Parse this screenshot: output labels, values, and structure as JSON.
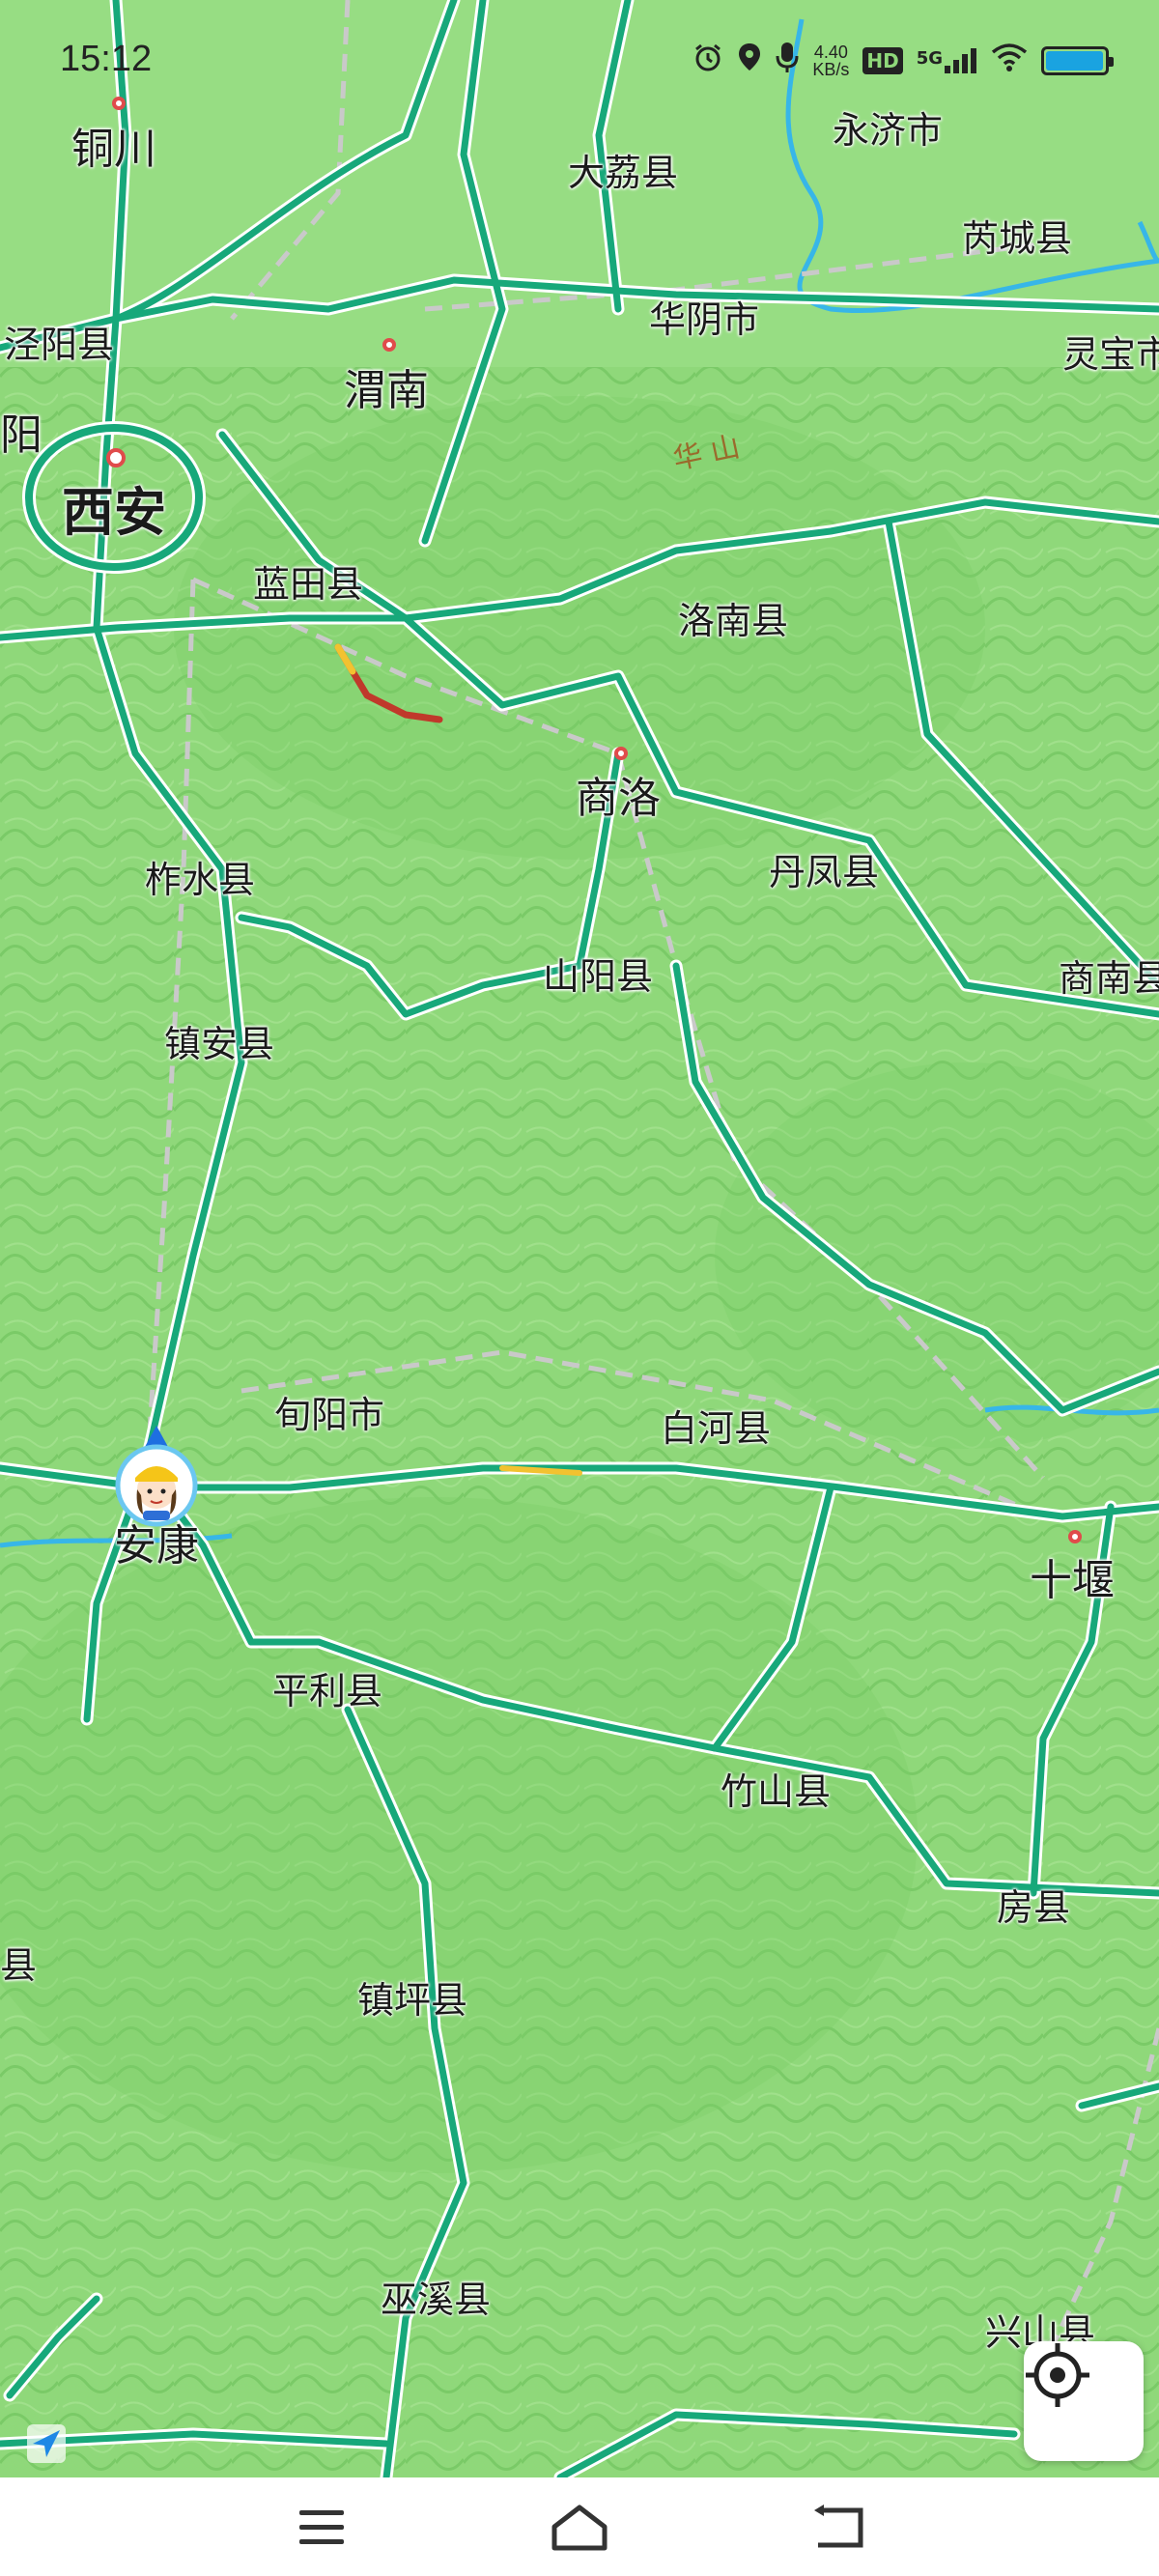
{
  "status_bar": {
    "time": "15:12",
    "net_speed_value": "4.40",
    "net_speed_unit": "KB/s",
    "hd_badge": "HD",
    "network_type": "5G",
    "battery_level": 0.92,
    "icons": [
      "alarm-icon",
      "location-icon",
      "microphone-icon",
      "hd-icon",
      "signal-icon",
      "wifi-icon",
      "battery-icon"
    ]
  },
  "map": {
    "place_labels": [
      {
        "id": "tongchuan",
        "text": "铜川",
        "kind": "city"
      },
      {
        "id": "dali",
        "text": "大荔县",
        "kind": "county"
      },
      {
        "id": "yongji",
        "text": "永济市",
        "kind": "county"
      },
      {
        "id": "ruicheng",
        "text": "芮城县",
        "kind": "county"
      },
      {
        "id": "jingyang",
        "text": "泾阳县",
        "kind": "county"
      },
      {
        "id": "weinan",
        "text": "渭南",
        "kind": "city"
      },
      {
        "id": "huayin",
        "text": "华阴市",
        "kind": "county"
      },
      {
        "id": "lingbao",
        "text": "灵宝市",
        "kind": "county"
      },
      {
        "id": "xianyang",
        "text": "阳",
        "kind": "city"
      },
      {
        "id": "xian",
        "text": "西安",
        "kind": "major"
      },
      {
        "id": "huashan",
        "text": "华 山",
        "kind": "mountain"
      },
      {
        "id": "lantian",
        "text": "蓝田县",
        "kind": "county"
      },
      {
        "id": "luonan",
        "text": "洛南县",
        "kind": "county"
      },
      {
        "id": "shangluo",
        "text": "商洛",
        "kind": "city"
      },
      {
        "id": "zhashui",
        "text": "柞水县",
        "kind": "county"
      },
      {
        "id": "danfeng",
        "text": "丹凤县",
        "kind": "county"
      },
      {
        "id": "shanyang",
        "text": "山阳县",
        "kind": "county"
      },
      {
        "id": "shangnan",
        "text": "商南县",
        "kind": "county"
      },
      {
        "id": "zhenan",
        "text": "镇安县",
        "kind": "county"
      },
      {
        "id": "xunyang",
        "text": "旬阳市",
        "kind": "county"
      },
      {
        "id": "baihe",
        "text": "白河县",
        "kind": "county"
      },
      {
        "id": "ankang",
        "text": "安康",
        "kind": "city"
      },
      {
        "id": "shiyan",
        "text": "十堰",
        "kind": "city"
      },
      {
        "id": "pingli",
        "text": "平利县",
        "kind": "county"
      },
      {
        "id": "zhushan",
        "text": "竹山县",
        "kind": "county"
      },
      {
        "id": "fangxian",
        "text": "房县",
        "kind": "county"
      },
      {
        "id": "edge_county",
        "text": "县",
        "kind": "county"
      },
      {
        "id": "zhenping",
        "text": "镇坪县",
        "kind": "county"
      },
      {
        "id": "wuxi",
        "text": "巫溪县",
        "kind": "county"
      },
      {
        "id": "xingshan",
        "text": "兴山县",
        "kind": "county"
      }
    ],
    "colors": {
      "land": "#8fd87a",
      "road": "#17a87a",
      "road_casing": "#ffffff",
      "railway": "#c9c9c9",
      "river": "#37b6e8",
      "traffic_congested": "#c0392b",
      "traffic_slow": "#f2c230",
      "city_dot": "#e04b4b"
    }
  },
  "controls": {
    "locate_button_icon": "crosshair-locate-icon",
    "user_marker_icon": "user-avatar-marker-icon",
    "corner_nav_icon": "navigation-arrow-icon"
  },
  "nav_bar": {
    "menu_icon": "menu-icon",
    "home_icon": "home-icon",
    "back_icon": "back-icon"
  }
}
